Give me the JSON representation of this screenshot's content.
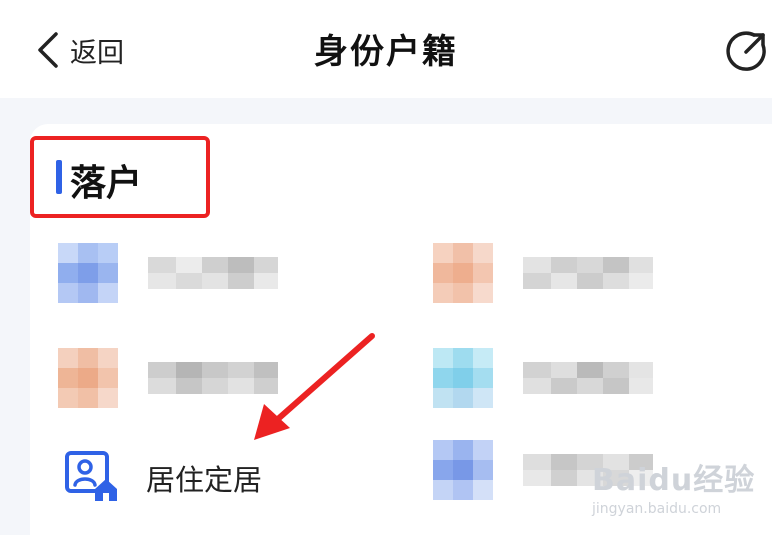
{
  "header": {
    "back_label": "返回",
    "title": "身份户籍"
  },
  "section": {
    "title": "落户",
    "accent_color": "#2f62e6",
    "highlight_color": "#ec2222"
  },
  "services": [
    {
      "label": "",
      "icon": "blurred-blue-icon"
    },
    {
      "label": "",
      "icon": "blurred-orange-icon"
    },
    {
      "label": "",
      "icon": "blurred-orange-icon"
    },
    {
      "label": "",
      "icon": "blurred-cyan-icon"
    },
    {
      "label": "居住定居",
      "icon": "residence-house-icon"
    },
    {
      "label": "",
      "icon": "blurred-blue-icon"
    }
  ],
  "watermark": {
    "logo": "Baidu经验",
    "url": "jingyan.baidu.com"
  }
}
